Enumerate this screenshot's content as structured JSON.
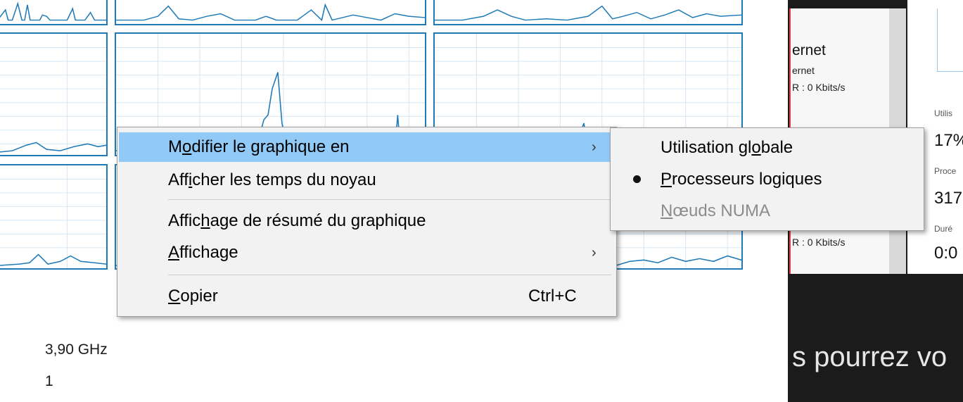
{
  "context_menu": {
    "items": [
      {
        "pre": "M",
        "ul": "o",
        "post": "difier le graphique en",
        "submenu": true,
        "highlighted": true
      },
      {
        "pre": "Aff",
        "ul": "i",
        "post": "cher les temps du noyau"
      },
      {
        "pre": "Affic",
        "ul": "h",
        "post": "age de résumé du graphique"
      },
      {
        "pre": "",
        "ul": "A",
        "post": "ffichage",
        "submenu": true
      },
      {
        "pre": "",
        "ul": "C",
        "post": "opier",
        "shortcut": "Ctrl+C"
      }
    ],
    "arrow": "›"
  },
  "submenu": {
    "items": [
      {
        "pre": "Utilisation gl",
        "ul": "o",
        "post": "bale",
        "selected": false,
        "enabled": true
      },
      {
        "pre": "",
        "ul": "P",
        "post": "rocesseurs logiques",
        "selected": true,
        "enabled": true
      },
      {
        "pre": "",
        "ul": "N",
        "post": "œuds NUMA",
        "selected": false,
        "enabled": false
      }
    ]
  },
  "stats": {
    "speed": "3,90 GHz",
    "sockets": "1"
  },
  "network": {
    "title": "ernet",
    "subtitle": "ernet",
    "rate_1": "R : 0 Kbits/s",
    "rate_2": "R : 0 Kbits/s"
  },
  "performance": {
    "label_1": "Utilis",
    "value_1": "17%",
    "label_2": "Proce",
    "value_2": "317",
    "label_3": "Duré",
    "value_3": "0:0"
  },
  "banner": {
    "text": "s pourrez vo"
  },
  "colors": {
    "graph_line": "#1f7ab8",
    "menu_highlight": "#91c9f7",
    "menu_bg": "#f2f2f2",
    "dark_background": "#1b1b1b"
  }
}
